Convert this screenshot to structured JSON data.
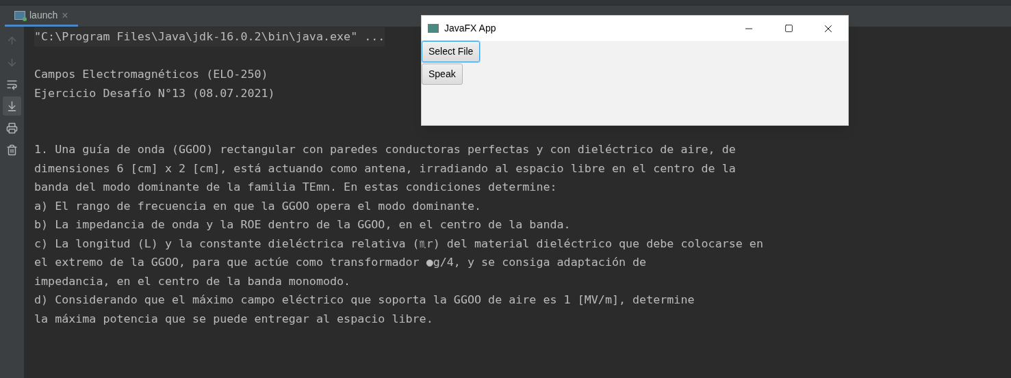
{
  "tab": {
    "label": "launch",
    "close": "×",
    "selected": true
  },
  "toolbar": [
    {
      "kind": "up",
      "disabled": true,
      "selected": false
    },
    {
      "kind": "down",
      "disabled": true,
      "selected": false
    },
    {
      "kind": "wrap",
      "disabled": false,
      "selected": false
    },
    {
      "kind": "scroll",
      "disabled": false,
      "selected": true
    },
    {
      "kind": "print",
      "disabled": false,
      "selected": false
    },
    {
      "kind": "trash",
      "disabled": false,
      "selected": false
    }
  ],
  "console": {
    "command": "\"C:\\Program Files\\Java\\jdk-16.0.2\\bin\\java.exe\" ...",
    "header": [
      "Campos Electromagnéticos (ELO-250)",
      "Ejercicio Desafío N°13 (08.07.2021)"
    ],
    "body": [
      "1. Una guía de onda (GGOO) rectangular con paredes conductoras perfectas y con dieléctrico de aire, de",
      "dimensiones 6 [cm] x 2 [cm], está actuando como antena, irradiando al espacio libre en el centro de la",
      "banda del modo dominante de la familia TEmn. En estas condiciones determine:",
      "a) El rango de frecuencia en que la GGOO opera el modo dominante.",
      "b) La impedancia de onda y la ROE dentro de la GGOO, en el centro de la banda.",
      "c) La longitud (L) y la constante dieléctrica relativa (♏r) del material dieléctrico que debe colocarse en",
      "el extremo de la GGOO, para que actúe como transformador ●g/4, y se consiga adaptación de",
      "impedancia, en el centro de la banda monomodo.",
      "d) Considerando que el máximo campo eléctrico que soporta la GGOO de aire es 1 [MV/m], determine",
      "la máxima potencia que se puede entregar al espacio libre."
    ]
  },
  "app_window": {
    "title": "JavaFX App",
    "buttons": [
      {
        "label": "Select File",
        "focused": true
      },
      {
        "label": "Speak",
        "focused": false
      }
    ]
  }
}
